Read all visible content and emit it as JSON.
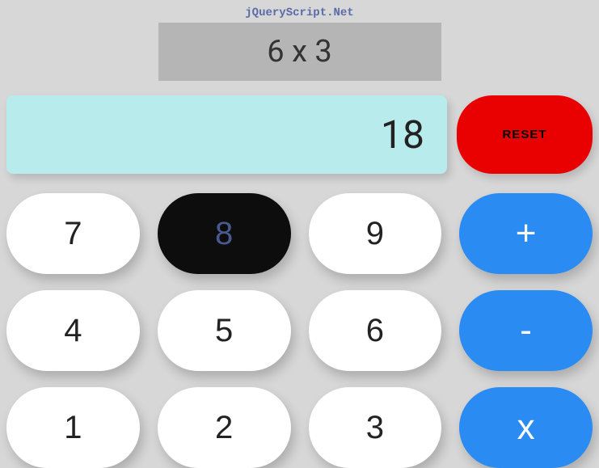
{
  "site_title": "jQueryScript.Net",
  "expression": "6 x 3",
  "result": "18",
  "reset_label": "RESET",
  "keypad": {
    "row1": {
      "c1": "7",
      "c2": "8",
      "c3": "9",
      "op": "+"
    },
    "row2": {
      "c1": "4",
      "c2": "5",
      "c3": "6",
      "op": "-"
    },
    "row3": {
      "c1": "1",
      "c2": "2",
      "c3": "3",
      "op": "x"
    }
  }
}
